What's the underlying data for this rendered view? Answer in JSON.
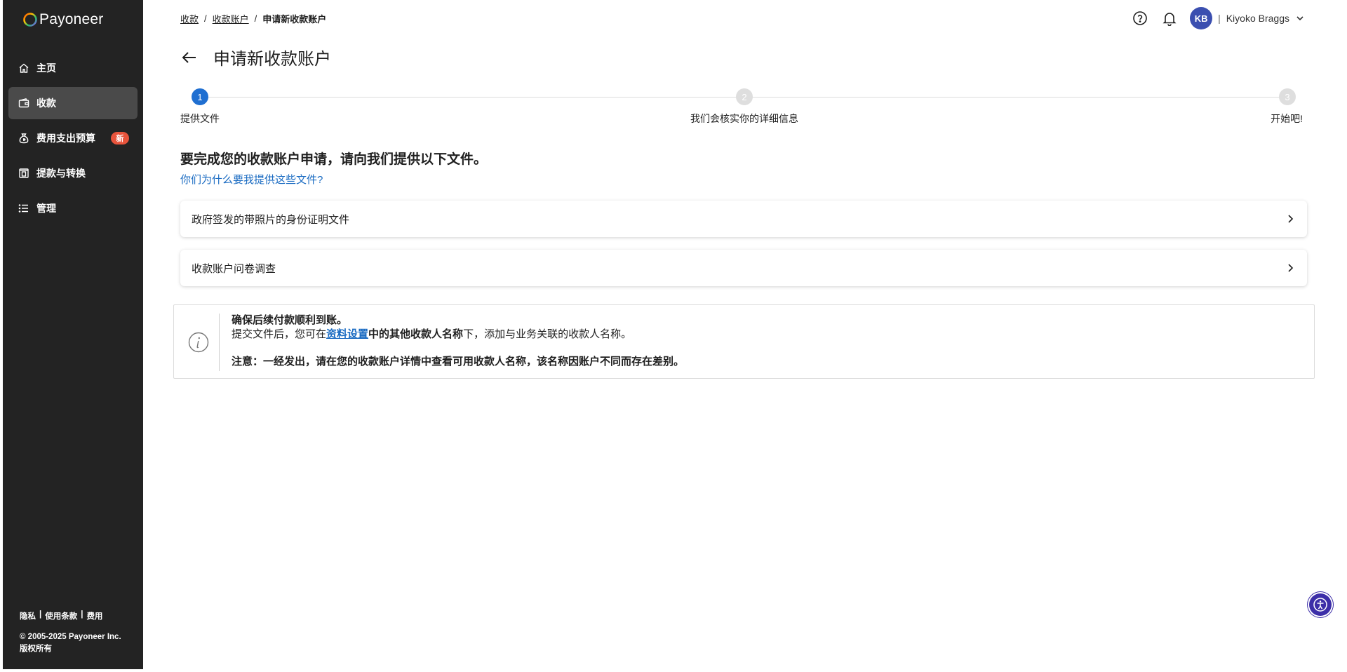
{
  "brand": {
    "name": "Payoneer"
  },
  "sidebar": {
    "items": [
      {
        "label": "主页",
        "icon": "home-icon"
      },
      {
        "label": "收款",
        "icon": "wallet-icon"
      },
      {
        "label": "费用支出预算",
        "icon": "money-bag-icon",
        "badge": "新"
      },
      {
        "label": "提款与转换",
        "icon": "withdraw-icon"
      },
      {
        "label": "管理",
        "icon": "list-icon"
      }
    ],
    "active_index": 1,
    "footer": {
      "links": [
        "隐私",
        "使用条款",
        "费用"
      ],
      "separator": "|",
      "copyright": "© 2005-2025 Payoneer Inc.",
      "rights": "版权所有"
    }
  },
  "breadcrumb": {
    "items": [
      "收款",
      "收款账户"
    ],
    "current": "申请新收款账户",
    "separator": "/"
  },
  "header": {
    "user_initials": "KB",
    "user_separator": "|",
    "user_name": "Kiyoko Braggs"
  },
  "page": {
    "title": "申请新收款账户"
  },
  "stepper": {
    "steps": [
      {
        "number": "1",
        "label": "提供文件"
      },
      {
        "number": "2",
        "label": "我们会核实你的详细信息"
      },
      {
        "number": "3",
        "label": "开始吧!"
      }
    ],
    "active_index": 0
  },
  "intro": {
    "heading": "要完成您的收款账户申请，请向我们提供以下文件。",
    "why_link": "你们为什么要我提供这些文件?"
  },
  "cards": [
    {
      "label": "政府签发的带照片的身份证明文件"
    },
    {
      "label": "收款账户问卷调查"
    }
  ],
  "info": {
    "title": "确保后续付款顺利到账。",
    "line_prefix": "提交文件后，您可在",
    "link": "资料设置",
    "line_mid": "中的",
    "line_bold": "其他收款人名称",
    "line_suffix": "下，添加与业务关联的收款人名称。",
    "note": "注意：一经发出，请在您的收款账户详情中查看可用收款人名称，该名称因账户不同而存在差别。"
  },
  "colors": {
    "sidebar_bg": "#232323",
    "accent_blue": "#1f6fd1",
    "link_blue": "#1a6bc2",
    "badge_red": "#e8543c",
    "avatar_bg": "#3b4fb0"
  }
}
